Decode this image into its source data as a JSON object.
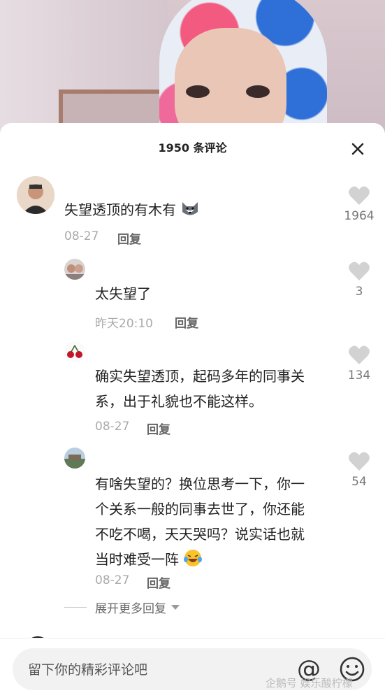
{
  "header": {
    "title": "1950 条评论"
  },
  "comments": [
    {
      "text": "失望透顶的有木有",
      "date": "08-27",
      "reply_label": "回复",
      "likes": "1964"
    },
    {
      "text": "太失望了",
      "date": "昨天20:10",
      "reply_label": "回复",
      "likes": "3"
    },
    {
      "text_lines": [
        "确实失望透顶，起码多年的同事关",
        "系，出于礼貌也不能这样。"
      ],
      "date": "08-27",
      "reply_label": "回复",
      "likes": "134"
    },
    {
      "text_lines": [
        "有啥失望的？换位思考一下，你一",
        "个关系一般的同事去世了，你还能",
        "不吃不喝，天天哭吗？说实话也就",
        "当时难受一阵"
      ],
      "date": "08-27",
      "reply_label": "回复",
      "likes": "54"
    }
  ],
  "expand_label": "展开更多回复",
  "input": {
    "placeholder": "留下你的精彩评论吧"
  },
  "at_symbol": "@",
  "watermark": "企鹅号 娱乐酸柠檬",
  "icons": {
    "close": "close-icon",
    "like": "heart-icon",
    "emoji": "smiley-icon",
    "chevron": "chevron-down-icon"
  }
}
